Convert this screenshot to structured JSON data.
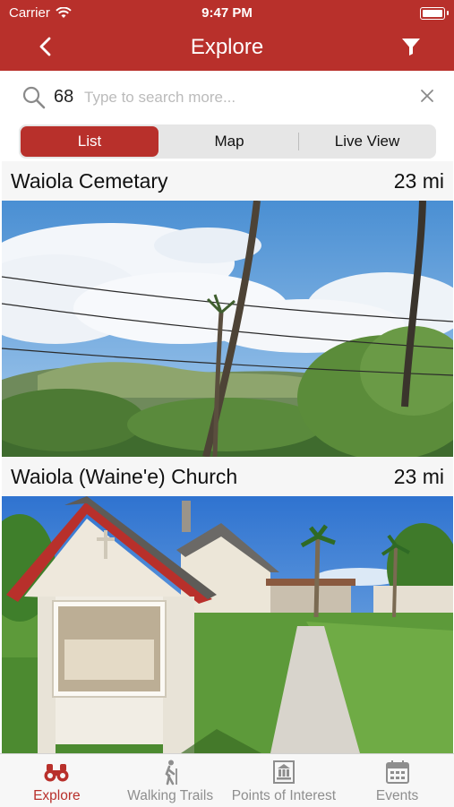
{
  "status": {
    "carrier": "Carrier",
    "time": "9:47 PM"
  },
  "nav": {
    "title": "Explore"
  },
  "search": {
    "count": "68",
    "placeholder": "Type to search more..."
  },
  "segments": [
    "List",
    "Map",
    "Live View"
  ],
  "items": [
    {
      "title": "Waiola Cemetary",
      "distance": "23 mi"
    },
    {
      "title": "Waiola (Waine'e) Church",
      "distance": "23 mi"
    }
  ],
  "tabs": [
    {
      "label": "Explore",
      "icon": "binoculars-icon"
    },
    {
      "label": "Walking Trails",
      "icon": "hiker-icon"
    },
    {
      "label": "Points of Interest",
      "icon": "landmark-icon"
    },
    {
      "label": "Events",
      "icon": "calendar-icon"
    }
  ],
  "colors": {
    "brand": "#b8302b",
    "inactive": "#8e8e8e"
  }
}
